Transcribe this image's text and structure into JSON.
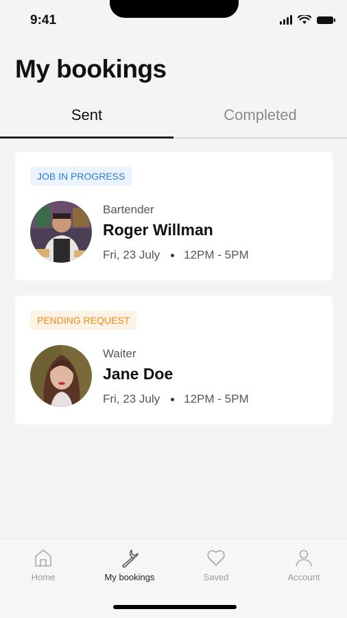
{
  "status_bar": {
    "time": "9:41"
  },
  "header": {
    "title": "My bookings"
  },
  "tabs": [
    {
      "label": "Sent",
      "active": true
    },
    {
      "label": "Completed",
      "active": false
    }
  ],
  "bookings": [
    {
      "status": "JOB IN PROGRESS",
      "status_color": "#2a7be0",
      "role": "Bartender",
      "name": "Roger Willman",
      "date": "Fri, 23 July",
      "time": "12PM - 5PM"
    },
    {
      "status": "PENDING REQUEST",
      "status_color": "#f08a1a",
      "role": "Waiter",
      "name": "Jane Doe",
      "date": "Fri, 23 July",
      "time": "12PM - 5PM"
    }
  ],
  "bottom_nav": [
    {
      "label": "Home",
      "icon": "home-icon",
      "active": false
    },
    {
      "label": "My bookings",
      "icon": "wrench-icon",
      "active": true
    },
    {
      "label": "Saved",
      "icon": "heart-icon",
      "active": false
    },
    {
      "label": "Account",
      "icon": "user-icon",
      "active": false
    }
  ]
}
